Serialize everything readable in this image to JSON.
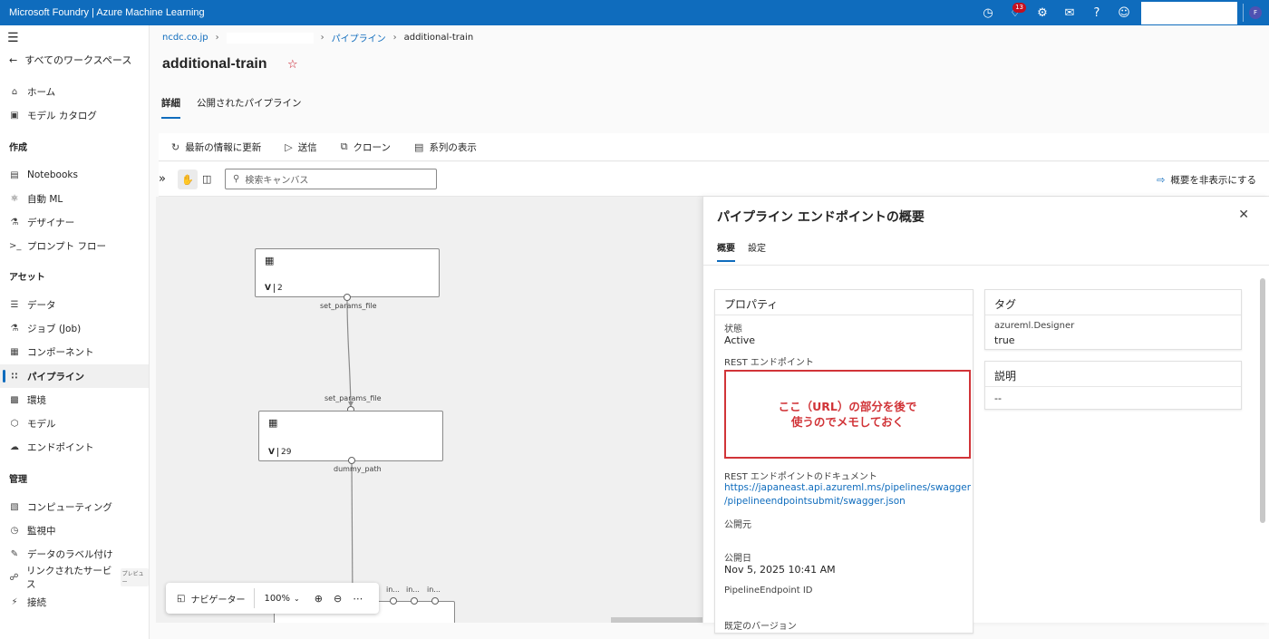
{
  "topbar": {
    "title": "Microsoft Foundry | Azure Machine Learning",
    "notification_count": "13",
    "avatar_initial": "F"
  },
  "sidebar": {
    "back_label": "すべてのワークスペース",
    "items_top": [
      {
        "label": "ホーム",
        "icon": "home-icon"
      },
      {
        "label": "モデル カタログ",
        "icon": "catalog-icon"
      }
    ],
    "section_author": "作成",
    "items_author": [
      {
        "label": "Notebooks",
        "icon": "notebook-icon"
      },
      {
        "label": "自動 ML",
        "icon": "automl-icon"
      },
      {
        "label": "デザイナー",
        "icon": "designer-icon"
      },
      {
        "label": "プロンプト フロー",
        "icon": "prompt-flow-icon"
      }
    ],
    "section_assets": "アセット",
    "items_assets": [
      {
        "label": "データ",
        "icon": "data-icon"
      },
      {
        "label": "ジョブ (Job)",
        "icon": "job-icon"
      },
      {
        "label": "コンポーネント",
        "icon": "component-icon"
      },
      {
        "label": "パイプライン",
        "icon": "pipeline-icon"
      },
      {
        "label": "環境",
        "icon": "environment-icon"
      },
      {
        "label": "モデル",
        "icon": "model-icon"
      },
      {
        "label": "エンドポイント",
        "icon": "endpoint-icon"
      }
    ],
    "section_manage": "管理",
    "items_manage": [
      {
        "label": "コンピューティング",
        "icon": "compute-icon"
      },
      {
        "label": "監視中",
        "icon": "monitor-icon"
      },
      {
        "label": "データのラベル付け",
        "icon": "label-icon"
      },
      {
        "label": "リンクされたサービス",
        "icon": "linked-service-icon",
        "badge": "プレビュー"
      },
      {
        "label": "接続",
        "icon": "connection-icon"
      }
    ]
  },
  "breadcrumb": {
    "org": "ncdc.co.jp",
    "pipelines": "パイプライン",
    "current": "additional-train"
  },
  "page": {
    "title": "additional-train",
    "tabs": [
      "詳細",
      "公開されたパイプライン"
    ]
  },
  "commands": {
    "refresh": "最新の情報に更新",
    "submit": "送信",
    "clone": "クローン",
    "show_lineage": "系列の表示"
  },
  "canvas": {
    "search_placeholder": "検索キャンバス",
    "hide_summary": "概要を非表示にする",
    "node1_version": "2",
    "node2_version": "29",
    "node_version_label": "V",
    "port1_out": "set_params_file",
    "port2_in": "set_params_file",
    "port2_out": "dummy_path",
    "bottom_ports": [
      "in...",
      "in...",
      "in..."
    ],
    "navigator_label": "ナビゲーター",
    "zoom_level": "100%"
  },
  "panel": {
    "title": "パイプライン エンドポイントの概要",
    "tabs": [
      "概要",
      "設定"
    ],
    "properties_header": "プロパティ",
    "status_label": "状態",
    "status_value": "Active",
    "rest_endpoint_label": "REST エンドポイント",
    "annotation": "ここ（URL）の部分を後で\n使うのでメモしておく",
    "rest_doc_label": "REST エンドポイントのドキュメント",
    "rest_doc_url_1": "https://japaneast.api.azureml.ms/pipelines/swagger",
    "rest_doc_url_2": "/pipelineendpointsubmit/swagger.json",
    "published_by_label": "公開元",
    "published_on_label": "公開日",
    "published_on_value": "Nov 5, 2025 10:41 AM",
    "endpoint_id_label": "PipelineEndpoint ID",
    "default_version_label": "既定のバージョン",
    "tags_header": "タグ",
    "tag_key": "azureml.Designer",
    "tag_value": "true",
    "description_header": "説明",
    "description_value": "--"
  },
  "colors": {
    "brand": "#0f6cbd",
    "annotation": "#d13438"
  }
}
